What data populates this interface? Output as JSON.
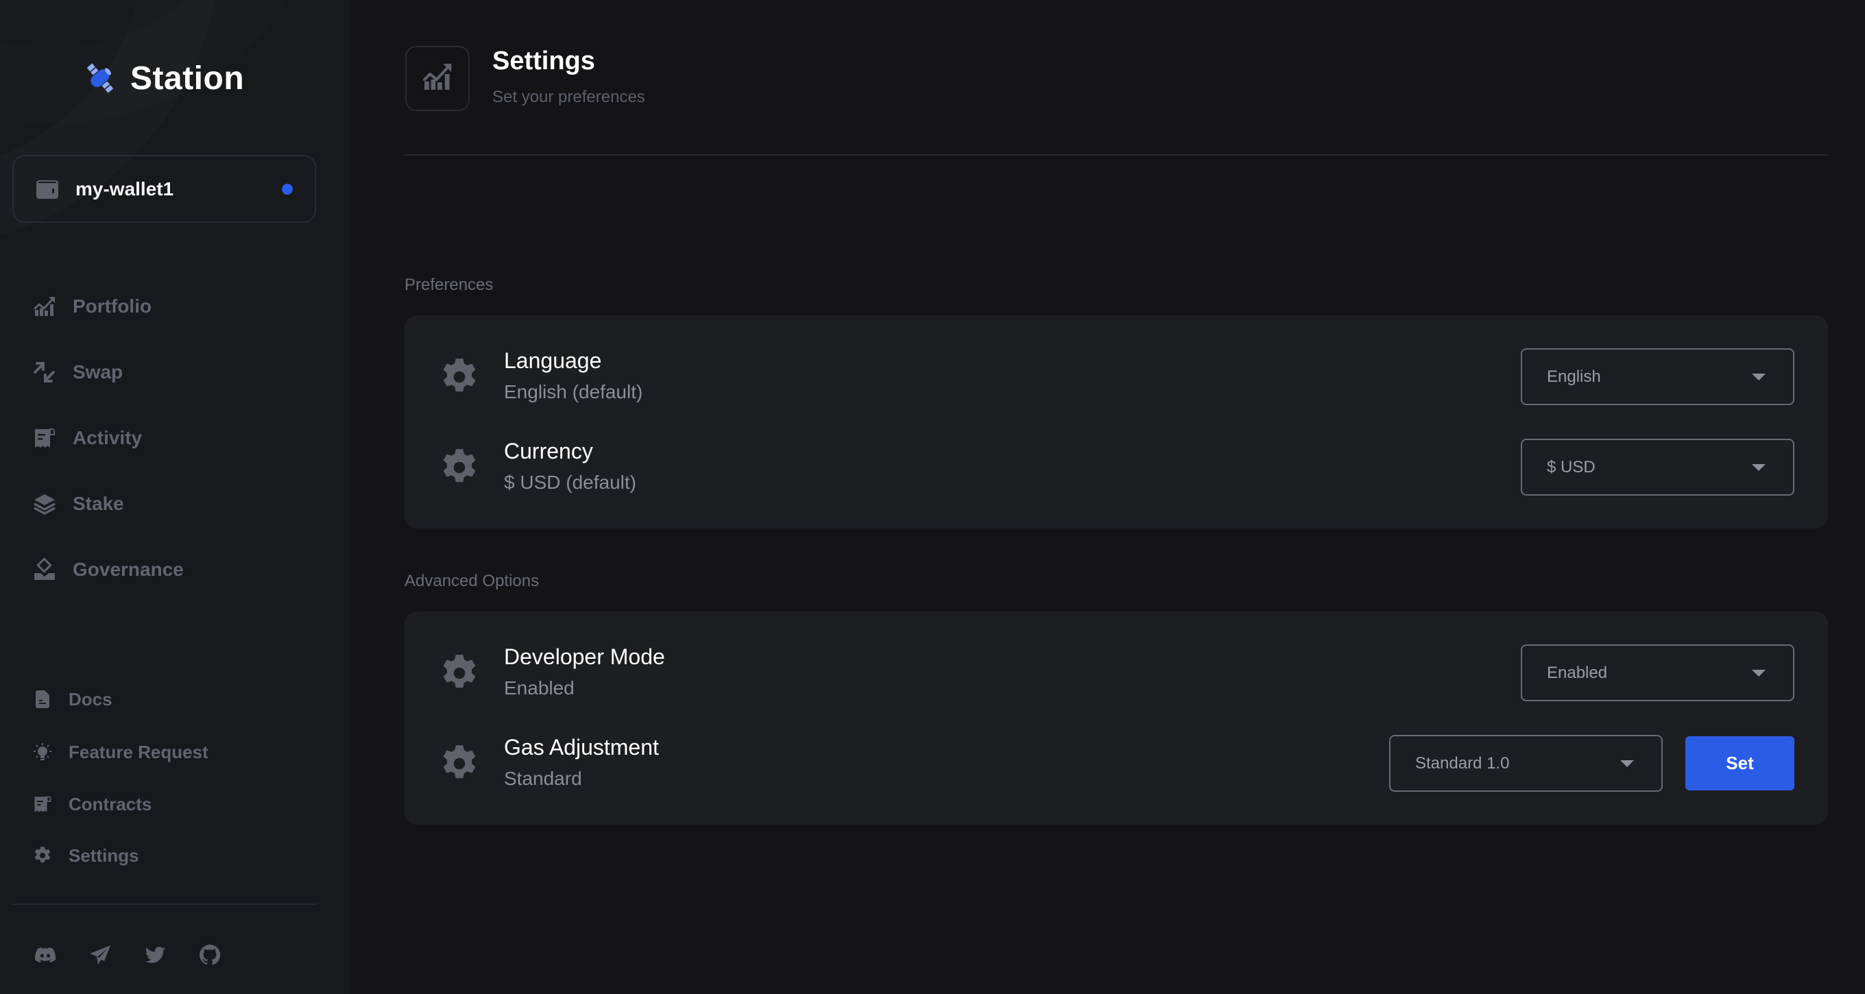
{
  "app": {
    "name": "Station",
    "accent_color": "#2b5ce6"
  },
  "wallet": {
    "name": "my-wallet1",
    "status_color": "#2b5ce6",
    "icon": "wallet-icon"
  },
  "sidebar": {
    "main_items": [
      {
        "label": "Portfolio",
        "icon": "chart-up-icon"
      },
      {
        "label": "Swap",
        "icon": "swap-arrows-icon"
      },
      {
        "label": "Activity",
        "icon": "receipt-icon"
      },
      {
        "label": "Stake",
        "icon": "layers-icon"
      },
      {
        "label": "Governance",
        "icon": "ballot-icon"
      }
    ],
    "secondary_items": [
      {
        "label": "Docs",
        "icon": "document-icon"
      },
      {
        "label": "Feature Request",
        "icon": "lightbulb-icon"
      },
      {
        "label": "Contracts",
        "icon": "receipt-icon"
      },
      {
        "label": "Settings",
        "icon": "gear-icon"
      }
    ],
    "social": [
      {
        "name": "Discord",
        "icon": "discord-icon"
      },
      {
        "name": "Telegram",
        "icon": "telegram-icon"
      },
      {
        "name": "Twitter",
        "icon": "twitter-icon"
      },
      {
        "name": "GitHub",
        "icon": "github-icon"
      }
    ]
  },
  "header": {
    "title": "Settings",
    "subtitle": "Set your preferences",
    "icon": "chart-up-icon"
  },
  "sections": [
    {
      "label": "Preferences",
      "rows": [
        {
          "title": "Language",
          "subtitle": "English (default)",
          "select_value": "English"
        },
        {
          "title": "Currency",
          "subtitle": "$ USD (default)",
          "select_value": "$ USD"
        }
      ]
    },
    {
      "label": "Advanced Options",
      "rows": [
        {
          "title": "Developer Mode",
          "subtitle": "Enabled",
          "select_value": "Enabled"
        },
        {
          "title": "Gas Adjustment",
          "subtitle": "Standard",
          "select_value": "Standard 1.0",
          "button_label": "Set"
        }
      ]
    }
  ]
}
